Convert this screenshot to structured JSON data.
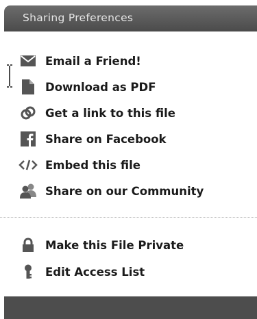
{
  "header": {
    "title": "Sharing Preferences"
  },
  "menu": {
    "items": [
      {
        "label": "Email a Friend!",
        "icon": "envelope-icon"
      },
      {
        "label": "Download as PDF",
        "icon": "document-icon"
      },
      {
        "label": "Get a link to this file",
        "icon": "link-icon"
      },
      {
        "label": "Share on Facebook",
        "icon": "facebook-icon"
      },
      {
        "label": "Embed this file",
        "icon": "code-icon"
      },
      {
        "label": "Share on our Community",
        "icon": "community-icon"
      }
    ]
  },
  "privacy": {
    "items": [
      {
        "label": "Make this File Private",
        "icon": "lock-icon"
      },
      {
        "label": "Edit Access List",
        "icon": "key-icon"
      }
    ]
  },
  "colors": {
    "header_bg": "#5a5a5a",
    "header_text": "#e6e6e6",
    "icon": "#555555",
    "label": "#1a1a1a",
    "footer_bg": "#4d4d4d"
  }
}
